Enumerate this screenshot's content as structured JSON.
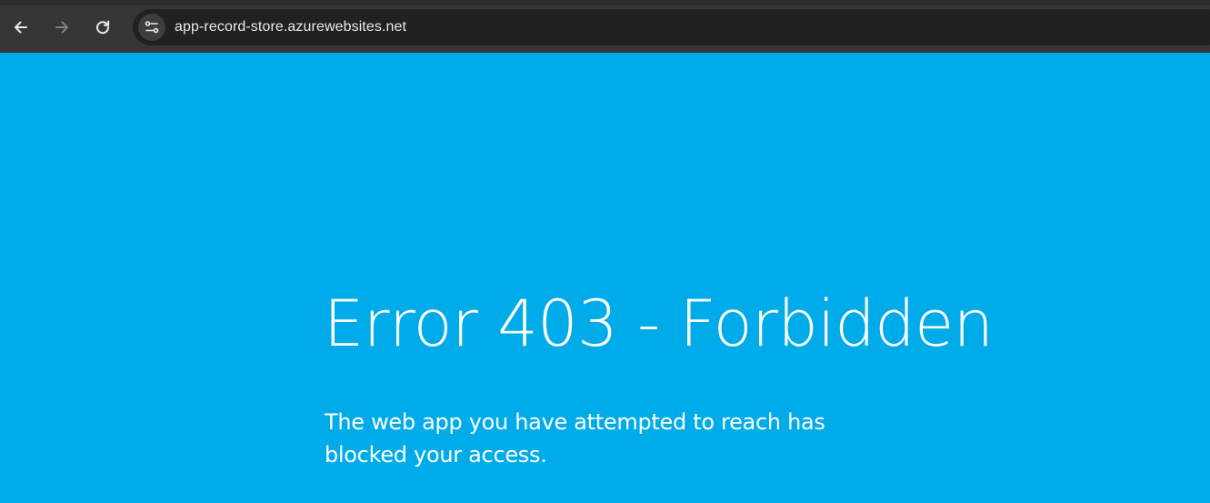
{
  "browser": {
    "url": "app-record-store.azurewebsites.net",
    "toolbar_color": "#35363a",
    "omnibox_color": "#202124",
    "buttons": {
      "back_icon": "arrow-left-icon",
      "forward_icon": "arrow-right-icon",
      "reload_icon": "reload-icon",
      "site_info_icon": "tune-icon"
    }
  },
  "page": {
    "background_color": "#00abe9",
    "title": "Error 403 - Forbidden",
    "message": "The web app you have attempted to reach has blocked your access."
  }
}
